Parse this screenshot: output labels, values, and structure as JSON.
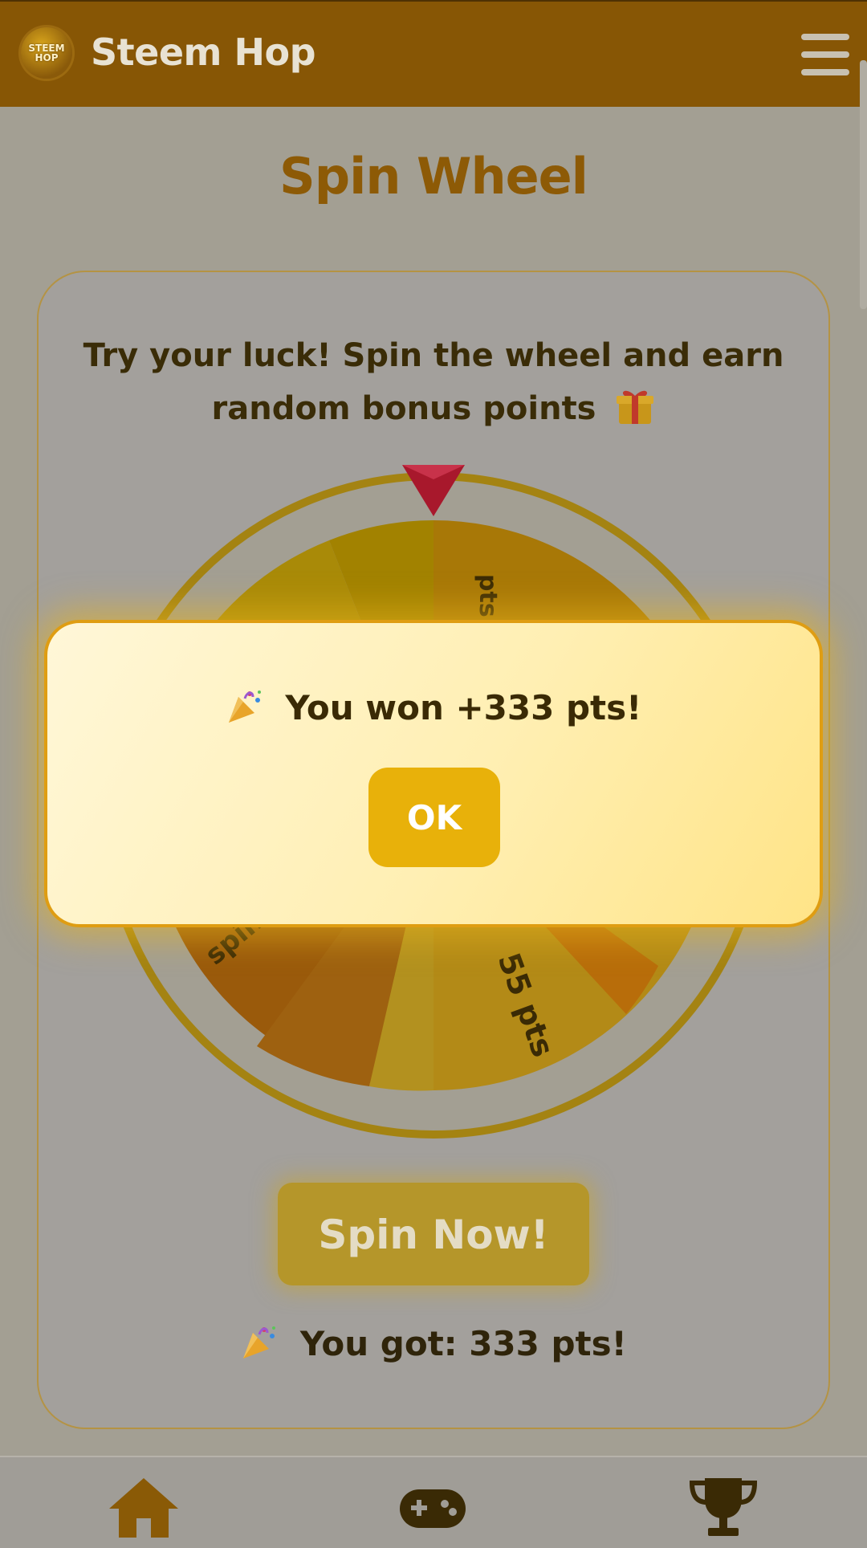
{
  "header": {
    "title": "Steem Hop",
    "logo_text": "STEEM HOP"
  },
  "page": {
    "title": "Spin Wheel"
  },
  "card": {
    "description": "Try your luck! Spin the wheel and earn random bonus points",
    "description_icon": "gift-icon",
    "wheel_labels": {
      "top": "pts",
      "bottom_right": "55 pts",
      "bottom_left": "spin"
    },
    "spin_button": "Spin Now!",
    "result_text": "You got: 333 pts!",
    "result_icon": "party-popper-icon"
  },
  "modal": {
    "message": "You won +333 pts!",
    "message_icon": "party-popper-icon",
    "ok_label": "OK"
  },
  "nav": {
    "items": [
      "home-icon",
      "gamepad-icon",
      "trophy-icon"
    ]
  },
  "colors": {
    "header_bg": "#875605",
    "accent": "#e8b10a",
    "title": "#8d5a06"
  }
}
